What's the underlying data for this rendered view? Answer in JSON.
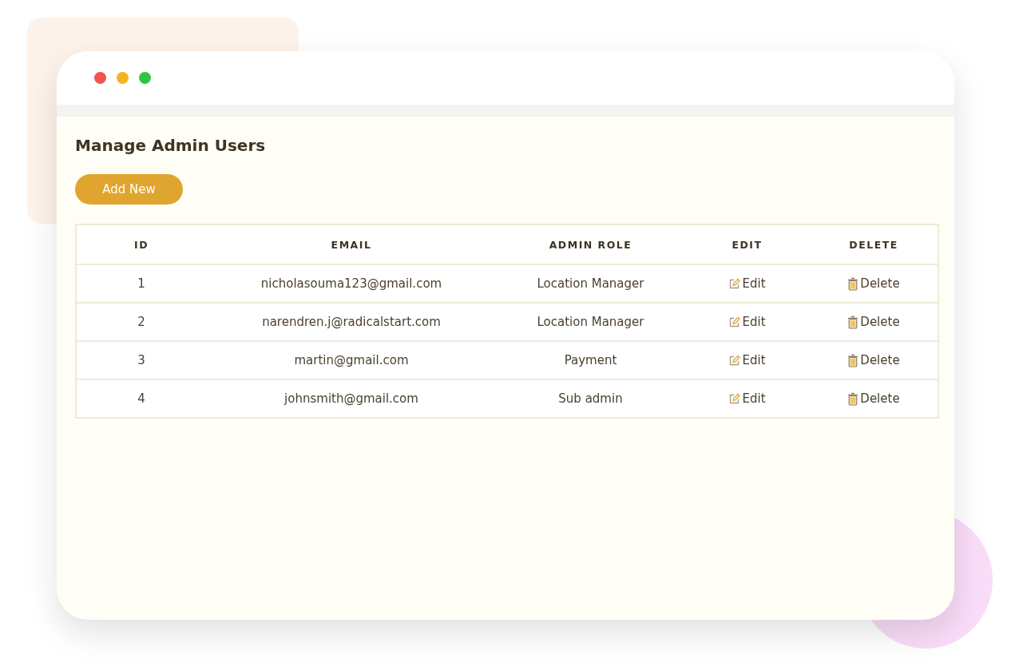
{
  "window": {
    "controls": [
      {
        "color": "#f0554f"
      },
      {
        "color": "#f5b324"
      },
      {
        "color": "#2fc645"
      }
    ]
  },
  "page": {
    "title": "Manage Admin Users",
    "add_button": "Add New"
  },
  "table": {
    "columns": [
      "ID",
      "EMAIL",
      "ADMIN ROLE",
      "EDIT",
      "DELETE"
    ],
    "rows": [
      {
        "id": "1",
        "email": "nicholasouma123@gmail.com",
        "role": "Location Manager",
        "edit": "Edit",
        "delete": "Delete"
      },
      {
        "id": "2",
        "email": "narendren.j@radicalstart.com",
        "role": "Location Manager",
        "edit": "Edit",
        "delete": "Delete"
      },
      {
        "id": "3",
        "email": "martin@gmail.com",
        "role": "Payment",
        "edit": "Edit",
        "delete": "Delete"
      },
      {
        "id": "4",
        "email": "johnsmith@gmail.com",
        "role": "Sub admin",
        "edit": "Edit",
        "delete": "Delete"
      }
    ]
  }
}
